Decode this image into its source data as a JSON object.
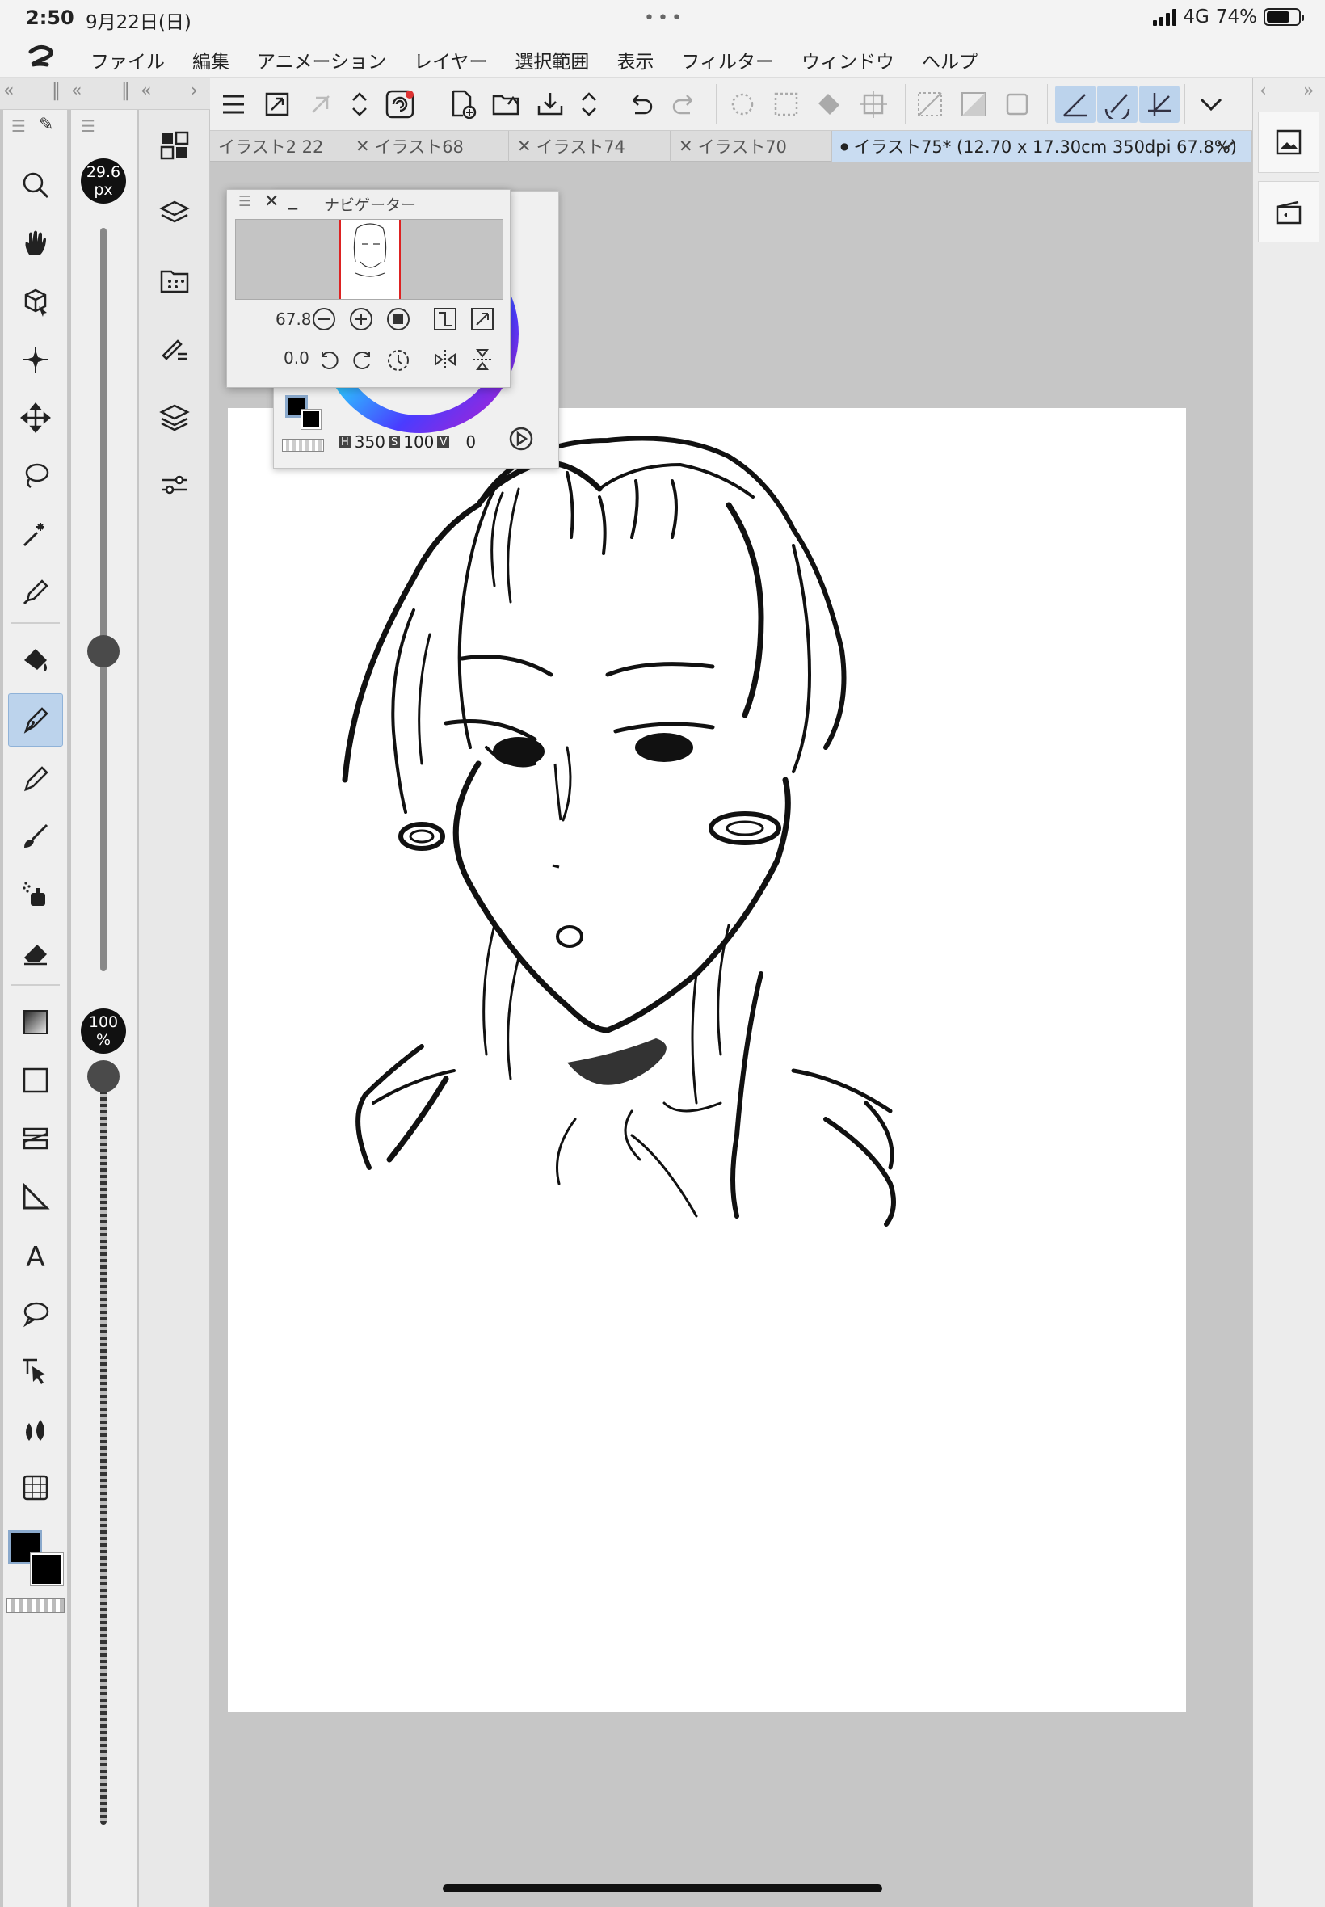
{
  "status": {
    "time": "2:50",
    "date": "9月22日(日)",
    "network": "4G",
    "battery": "74%",
    "battery_level": 0.74,
    "dots": "•••"
  },
  "menu": [
    "ファイル",
    "編集",
    "アニメーション",
    "レイヤー",
    "選択範囲",
    "表示",
    "フィルター",
    "ウィンドウ",
    "ヘルプ"
  ],
  "tabs": [
    {
      "label": "イラスト2 22",
      "closable": false
    },
    {
      "label": "イラスト68",
      "closable": true
    },
    {
      "label": "イラスト74",
      "closable": true
    },
    {
      "label": "イラスト70",
      "closable": true
    },
    {
      "label": "イラスト75* (12.70 x 17.30cm 350dpi 67.8%)",
      "closable": false,
      "active": true
    }
  ],
  "brush": {
    "size_value": "29.6",
    "size_unit": "px",
    "opacity_value": "100",
    "opacity_unit": "%",
    "size_level": 0.43,
    "opacity_level": 1.0
  },
  "navigator": {
    "title": "ナビゲーター",
    "zoom": "67.8",
    "rotation": "0.0"
  },
  "color": {
    "h_label": "H",
    "h": "350",
    "s_label": "S",
    "s": "100",
    "v_label": "V",
    "v": "0",
    "main": "#000000",
    "sub": "#000000"
  },
  "icons": {
    "tools": [
      "zoom-icon",
      "hand-icon",
      "3d-operation-icon",
      "auto-select-icon",
      "move-icon",
      "lasso-select-icon",
      "magic-wand-icon",
      "eyedropper-icon",
      "fill-icon",
      "pen-icon",
      "pencil-icon",
      "brush-icon",
      "airbrush-icon",
      "eraser-icon",
      "gradient-icon",
      "rectangle-icon",
      "frame-border-icon",
      "ruler-icon",
      "text-icon",
      "balloon-icon",
      "object-select-icon",
      "blend-icon",
      "grid-icon"
    ]
  }
}
